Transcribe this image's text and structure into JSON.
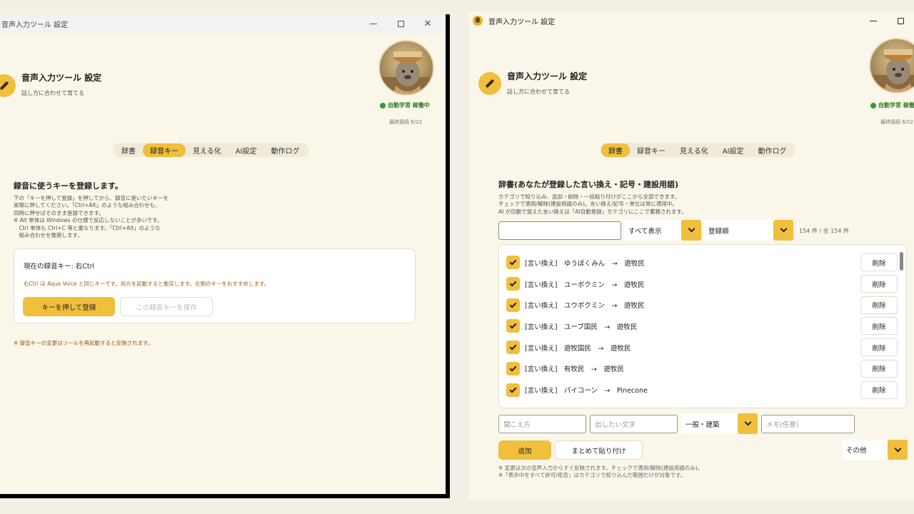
{
  "left": {
    "window_title": "音声入力ツール 設定",
    "app_title": "音声入力ツール 設定",
    "app_subtitle": "話し方に合わせて育てる",
    "status": "自動学習 稼働中",
    "last_update": "最終接続 6/22",
    "tabs": [
      "辞書",
      "録音キー",
      "見える化",
      "AI設定",
      "動作ログ"
    ],
    "active_tab": 1,
    "section_title": "録音に使うキーを登録します。",
    "desc_lines": [
      "下の「キーを押して登録」を押してから、録音に使いたいキーを",
      "実際に押してください。「Ctrl+Alt」のような組み合わせも、",
      "同時に押せばそのまま登録できます。",
      "※ Alt 単体は Windows の仕様で反応しないことが多いです。",
      "　Ctrl 単体も Ctrl+C 等と重なります。「Ctrl+Alt」のような",
      "　組み合わせを推奨します。"
    ],
    "current_key": "現在の録音キー: 右Ctrl",
    "warning": "右Ctrl は Aqua Voice と同じキーです。両方を起動すると衝突します。左側のキーをおすすめします。",
    "register_button": "キーを押して登録",
    "save_button": "この録音キーを保存",
    "footer_note": "※ 録音キーの変更はツールを再起動すると反映されます。"
  },
  "right": {
    "window_title": "音声入力ツール 設定",
    "app_title": "音声入力ツール 設定",
    "app_subtitle": "話し方に合わせて育てる",
    "status": "自動学習 稼働中",
    "last_update": "最終接続 6/22",
    "tabs": [
      "辞書",
      "録音キー",
      "見える化",
      "AI設定",
      "動作ログ"
    ],
    "active_tab": 0,
    "section_title": "辞書(あなたが登録した言い換え・記号・建設用語)",
    "desc_lines": [
      "カテゴリで絞り込み、追加・削除・一括貼り付けがここから全部できます。",
      "チェックで適用/解除(建設用語のみ)。言い換え/記号・単位は常に適用中。",
      "AI が自動で覚えた言い換えは「AI自動登録」カテゴリにここで蓄積されます。"
    ],
    "search_value": "",
    "filter_select": "すべて表示",
    "sort_select": "登録順",
    "count": "154 件 / 全 154 件",
    "entries": [
      {
        "text": "[言い換え]　ゆうぼくみん　→　遊牧民",
        "delete": "削除"
      },
      {
        "text": "[言い換え]　ユーボクミン　→　遊牧民",
        "delete": "削除"
      },
      {
        "text": "[言い換え]　ユウボクミン　→　遊牧民",
        "delete": "削除"
      },
      {
        "text": "[言い換え]　ユーブ国民　→　遊牧民",
        "delete": "削除"
      },
      {
        "text": "[言い換え]　遊牧国民　→　遊牧民",
        "delete": "削除"
      },
      {
        "text": "[言い換え]　有牧民　→　遊牧民",
        "delete": "削除"
      },
      {
        "text": "[言い換え]　パイコーン　→　Pinecone",
        "delete": "削除"
      }
    ],
    "new_reading_placeholder": "聞こえ方",
    "new_output_placeholder": "出したい文字",
    "new_category": "一般・建築",
    "new_memo_placeholder": "メモ(任意)",
    "add_button": "追加",
    "bulk_paste_button": "まとめて貼り付け",
    "other_select": "その他",
    "notes": [
      "※ 変更は次の音声入力からすぐ反映されます。チェックで適用/解除(建設用語のみ)。",
      "※「表示中をすべて許可/拒否」はカテゴリで絞り込んだ範囲だけが対象です。"
    ]
  },
  "colors": {
    "accent": "#f0bf3c",
    "background": "#faf6ea",
    "status_green": "#2f9e2f",
    "warning_text": "#a0601a"
  },
  "icons": [
    "microphone-icon",
    "minimize-icon",
    "maximize-icon",
    "close-icon",
    "chevron-down-icon",
    "checkbox-checked-icon"
  ]
}
